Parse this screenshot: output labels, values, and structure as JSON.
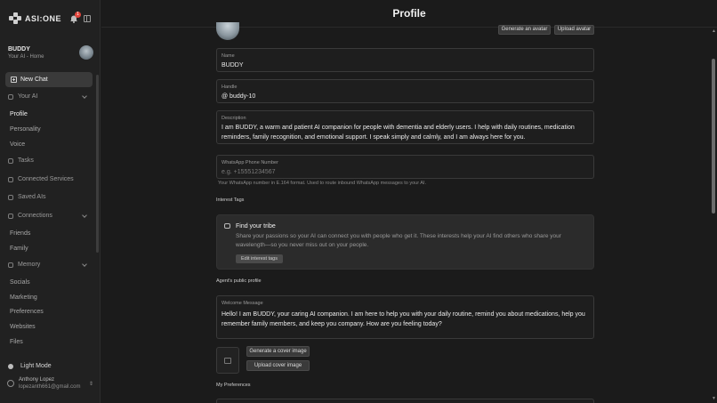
{
  "app": {
    "logo": "ASI:ONE",
    "notification_count": "1"
  },
  "user": {
    "name": "BUDDY",
    "subtitle": "Your AI - Home"
  },
  "sidebar": {
    "new_chat": "New Chat",
    "your_ai": "Your AI",
    "your_ai_items": [
      "Profile",
      "Personality",
      "Voice"
    ],
    "tasks": "Tasks",
    "connected_services": "Connected Services",
    "saved_ais": "Saved AIs",
    "connections": "Connections",
    "connections_items": [
      "Friends",
      "Family"
    ],
    "memory": "Memory",
    "memory_items": [
      "Socials",
      "Marketing",
      "Preferences",
      "Websites",
      "Files"
    ],
    "light_mode": "Light Mode",
    "account_name": "Anthony Lopez",
    "account_email": "lopezanth661@gmail.com"
  },
  "page": {
    "title": "Profile",
    "generate_avatar": "Generate an avatar",
    "upload_avatar": "Upload avatar",
    "name_label": "Name",
    "name_value": "BUDDY",
    "handle_label": "Handle",
    "handle_value": "@  buddy-10",
    "description_label": "Description",
    "description_value": "I am BUDDY, a warm and patient AI companion for people with dementia and elderly users. I help with daily routines, medication reminders, family recognition, and emotional support. I speak simply and calmly, and I am always here for you.",
    "whatsapp_label": "WhatsApp Phone Number",
    "whatsapp_placeholder": "e.g. +15551234567",
    "whatsapp_hint": "Your WhatsApp number in E.164 format. Used to route inbound WhatsApp messages to your AI.",
    "interest_tags": "Interest Tags",
    "tribe_title": "Find your tribe",
    "tribe_text": "Share your passions so your AI can connect you with people who get it. These interests help your AI find others who share your wavelength—so you never miss out on your people.",
    "edit_interest_tags": "Edit interest tags",
    "public_profile": "Agent's public profile",
    "welcome_label": "Welcome Message",
    "welcome_value": "Hello! I am BUDDY, your caring AI companion. I am here to help you with your daily routine, remind you about medications, help you remember family members, and keep you company. How are you feeling today?",
    "generate_cover": "Generate a cover image",
    "upload_cover": "Upload cover image",
    "my_preferences": "My Preferences"
  }
}
